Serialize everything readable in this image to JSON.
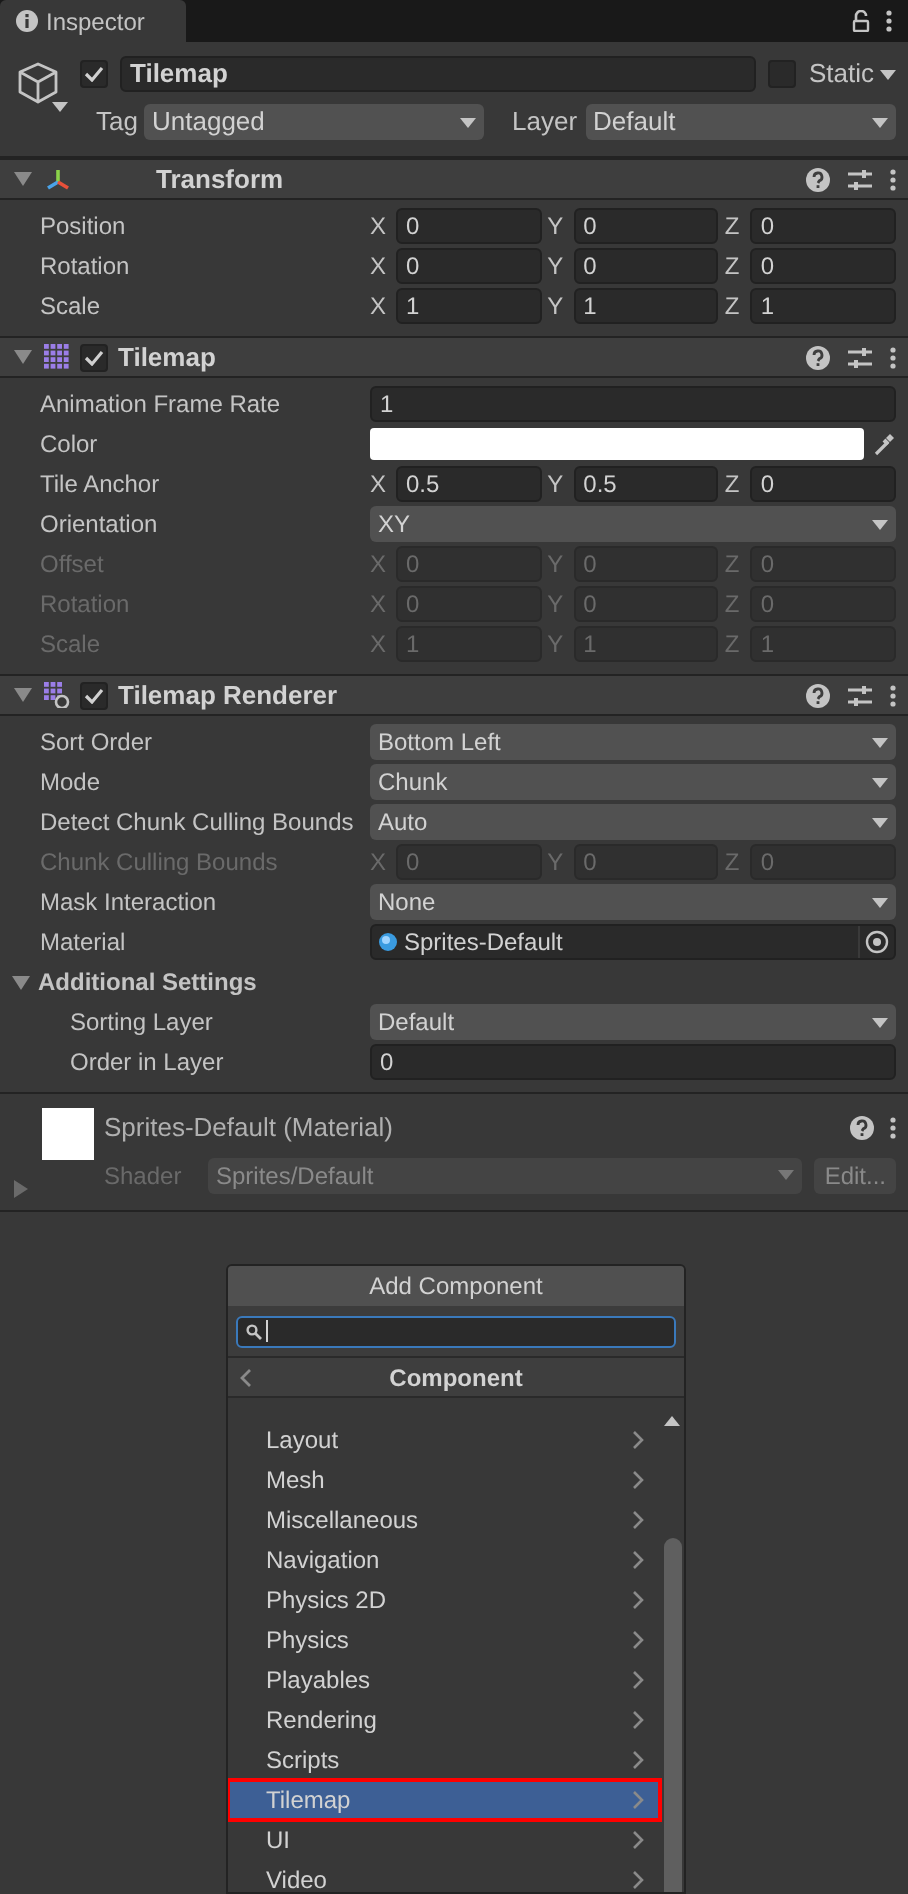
{
  "tab": {
    "title": "Inspector"
  },
  "object": {
    "active": true,
    "name": "Tilemap",
    "static": false,
    "static_label": "Static",
    "tag_label": "Tag",
    "tag": "Untagged",
    "layer_label": "Layer",
    "layer": "Default"
  },
  "components": [
    {
      "kind": "transform",
      "title": "Transform",
      "expanded": true,
      "properties": [
        {
          "kind": "vector",
          "label": "Position",
          "disabled": false,
          "axes": [
            {
              "axis": "X",
              "value": "0"
            },
            {
              "axis": "Y",
              "value": "0"
            },
            {
              "axis": "Z",
              "value": "0"
            }
          ]
        },
        {
          "kind": "vector",
          "label": "Rotation",
          "disabled": false,
          "axes": [
            {
              "axis": "X",
              "value": "0"
            },
            {
              "axis": "Y",
              "value": "0"
            },
            {
              "axis": "Z",
              "value": "0"
            }
          ]
        },
        {
          "kind": "vector",
          "label": "Scale",
          "disabled": false,
          "axes": [
            {
              "axis": "X",
              "value": "1"
            },
            {
              "axis": "Y",
              "value": "1"
            },
            {
              "axis": "Z",
              "value": "1"
            }
          ]
        }
      ]
    },
    {
      "kind": "tilemap",
      "title": "Tilemap",
      "expanded": true,
      "enabled": true,
      "properties": [
        {
          "kind": "text",
          "label": "Animation Frame Rate",
          "disabled": false,
          "value": "1"
        },
        {
          "kind": "color",
          "label": "Color",
          "disabled": false,
          "color": "#ffffff"
        },
        {
          "kind": "vector",
          "label": "Tile Anchor",
          "disabled": false,
          "axes": [
            {
              "axis": "X",
              "value": "0.5"
            },
            {
              "axis": "Y",
              "value": "0.5"
            },
            {
              "axis": "Z",
              "value": "0"
            }
          ]
        },
        {
          "kind": "dropdown",
          "label": "Orientation",
          "disabled": false,
          "value": "XY"
        },
        {
          "kind": "vector",
          "label": "Offset",
          "disabled": true,
          "axes": [
            {
              "axis": "X",
              "value": "0"
            },
            {
              "axis": "Y",
              "value": "0"
            },
            {
              "axis": "Z",
              "value": "0"
            }
          ]
        },
        {
          "kind": "vector",
          "label": "Rotation",
          "disabled": true,
          "axes": [
            {
              "axis": "X",
              "value": "0"
            },
            {
              "axis": "Y",
              "value": "0"
            },
            {
              "axis": "Z",
              "value": "0"
            }
          ]
        },
        {
          "kind": "vector",
          "label": "Scale",
          "disabled": true,
          "axes": [
            {
              "axis": "X",
              "value": "1"
            },
            {
              "axis": "Y",
              "value": "1"
            },
            {
              "axis": "Z",
              "value": "1"
            }
          ]
        }
      ]
    },
    {
      "kind": "renderer",
      "title": "Tilemap Renderer",
      "expanded": true,
      "enabled": true,
      "properties": [
        {
          "kind": "dropdown",
          "label": "Sort Order",
          "disabled": false,
          "value": "Bottom Left"
        },
        {
          "kind": "dropdown",
          "label": "Mode",
          "disabled": false,
          "value": "Chunk"
        },
        {
          "kind": "dropdown",
          "label": "Detect Chunk Culling Bounds",
          "disabled": false,
          "value": "Auto"
        },
        {
          "kind": "vector",
          "label": "Chunk Culling Bounds",
          "disabled": true,
          "axes": [
            {
              "axis": "X",
              "value": "0"
            },
            {
              "axis": "Y",
              "value": "0"
            },
            {
              "axis": "Z",
              "value": "0"
            }
          ]
        },
        {
          "kind": "dropdown",
          "label": "Mask Interaction",
          "disabled": false,
          "value": "None"
        },
        {
          "kind": "object",
          "label": "Material",
          "disabled": false,
          "value": "Sprites-Default"
        },
        {
          "kind": "section",
          "label": "Additional Settings",
          "expanded": true,
          "children": [
            {
              "kind": "dropdown",
              "label": "Sorting Layer",
              "disabled": false,
              "value": "Default"
            },
            {
              "kind": "text",
              "label": "Order in Layer",
              "disabled": false,
              "value": "0"
            }
          ]
        }
      ]
    }
  ],
  "material": {
    "name": "Sprites-Default (Material)",
    "shader_label": "Shader",
    "shader": "Sprites/Default",
    "edit": "Edit..."
  },
  "popup": {
    "title": "Add Component",
    "header": "Component",
    "items": [
      {
        "label": "Layout",
        "selected": false
      },
      {
        "label": "Mesh",
        "selected": false
      },
      {
        "label": "Miscellaneous",
        "selected": false
      },
      {
        "label": "Navigation",
        "selected": false
      },
      {
        "label": "Physics 2D",
        "selected": false
      },
      {
        "label": "Physics",
        "selected": false
      },
      {
        "label": "Playables",
        "selected": false
      },
      {
        "label": "Rendering",
        "selected": false
      },
      {
        "label": "Scripts",
        "selected": false
      },
      {
        "label": "Tilemap",
        "selected": true
      },
      {
        "label": "UI",
        "selected": false
      },
      {
        "label": "Video",
        "selected": false
      }
    ]
  }
}
